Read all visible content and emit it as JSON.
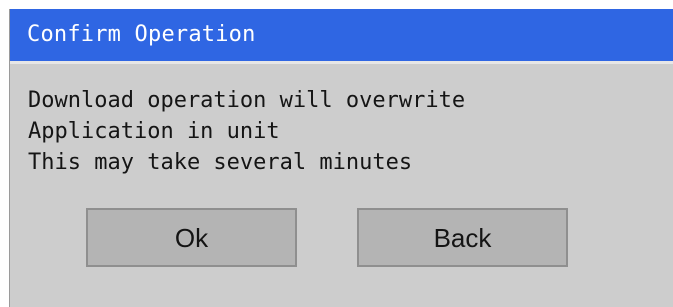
{
  "dialog": {
    "title": "Confirm Operation",
    "message_lines": [
      "Download operation will overwrite",
      "Application in unit",
      "This may take several minutes"
    ],
    "buttons": {
      "ok_label": "Ok",
      "back_label": "Back"
    }
  },
  "colors": {
    "titlebar_bg": "#2f66e3",
    "dialog_bg": "#cdcdcd",
    "button_bg": "#b4b4b4"
  }
}
